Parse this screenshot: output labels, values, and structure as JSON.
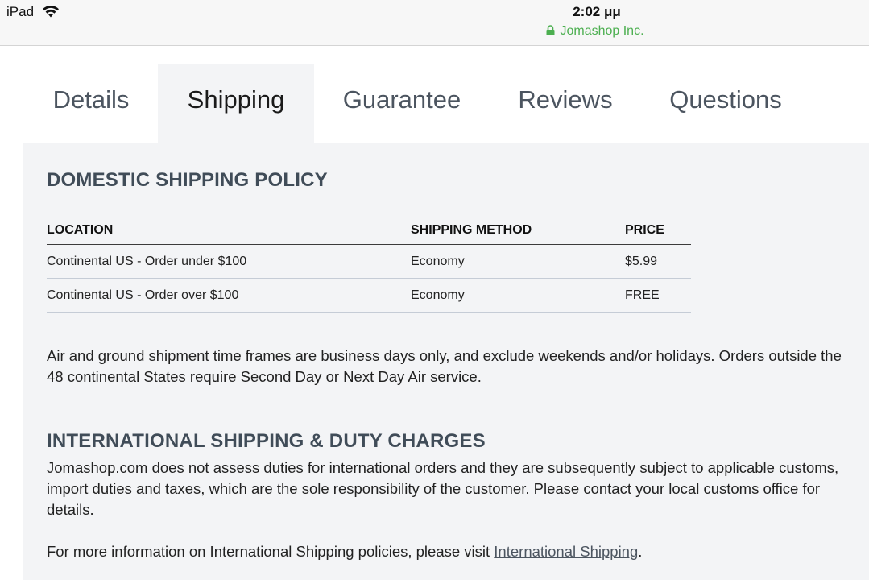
{
  "status_bar": {
    "device": "iPad",
    "time": "2:02 μμ",
    "site": "Jomashop Inc.",
    "site_color": "#4caf50"
  },
  "tabs": [
    {
      "label": "Details",
      "active": false
    },
    {
      "label": "Shipping",
      "active": true
    },
    {
      "label": "Guarantee",
      "active": false
    },
    {
      "label": "Reviews",
      "active": false
    },
    {
      "label": "Questions",
      "active": false
    }
  ],
  "domestic": {
    "title": "DOMESTIC SHIPPING POLICY",
    "headers": [
      "LOCATION",
      "SHIPPING METHOD",
      "PRICE"
    ],
    "rows": [
      [
        "Continental US - Order under $100",
        "Economy",
        "$5.99"
      ],
      [
        "Continental US - Order over $100",
        "Economy",
        "FREE"
      ]
    ],
    "note": "Air and ground shipment time frames are business days only, and exclude weekends and/or holidays. Orders outside the 48 continental States require Second Day or Next Day Air service."
  },
  "international": {
    "title": "INTERNATIONAL SHIPPING & DUTY CHARGES",
    "body": "Jomashop.com does not assess duties for international orders and they are subsequently subject to applicable customs, import duties and taxes, which are the sole responsibility of the customer. Please contact your local customs office for details.",
    "more_prefix": "For more information on International Shipping policies, please visit ",
    "more_link": "International Shipping",
    "more_suffix": "."
  },
  "colors": {
    "panel_bg": "#f3f4f6",
    "heading": "#404c58"
  }
}
